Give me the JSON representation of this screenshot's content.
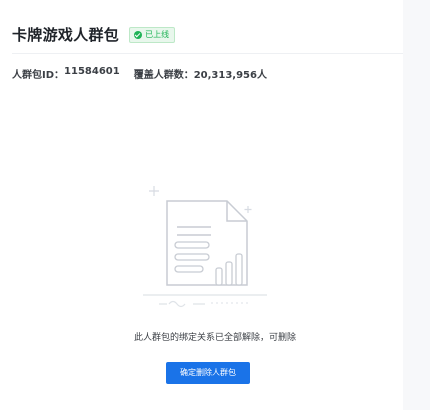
{
  "header": {
    "title": "卡牌游戏人群包",
    "status": {
      "label": "已上线",
      "color": "#1fb356"
    }
  },
  "meta": {
    "id_label": "人群包ID：",
    "id_value": "11584601",
    "coverage_label": "覆盖人群数：",
    "coverage_value": "20,313,956人"
  },
  "empty_state": {
    "icon": "empty-document-icon",
    "message": "此人群包的绑定关系已全部解除，可删除"
  },
  "actions": {
    "confirm_delete_label": "确定删除人群包",
    "accent_color": "#1a73e8"
  }
}
